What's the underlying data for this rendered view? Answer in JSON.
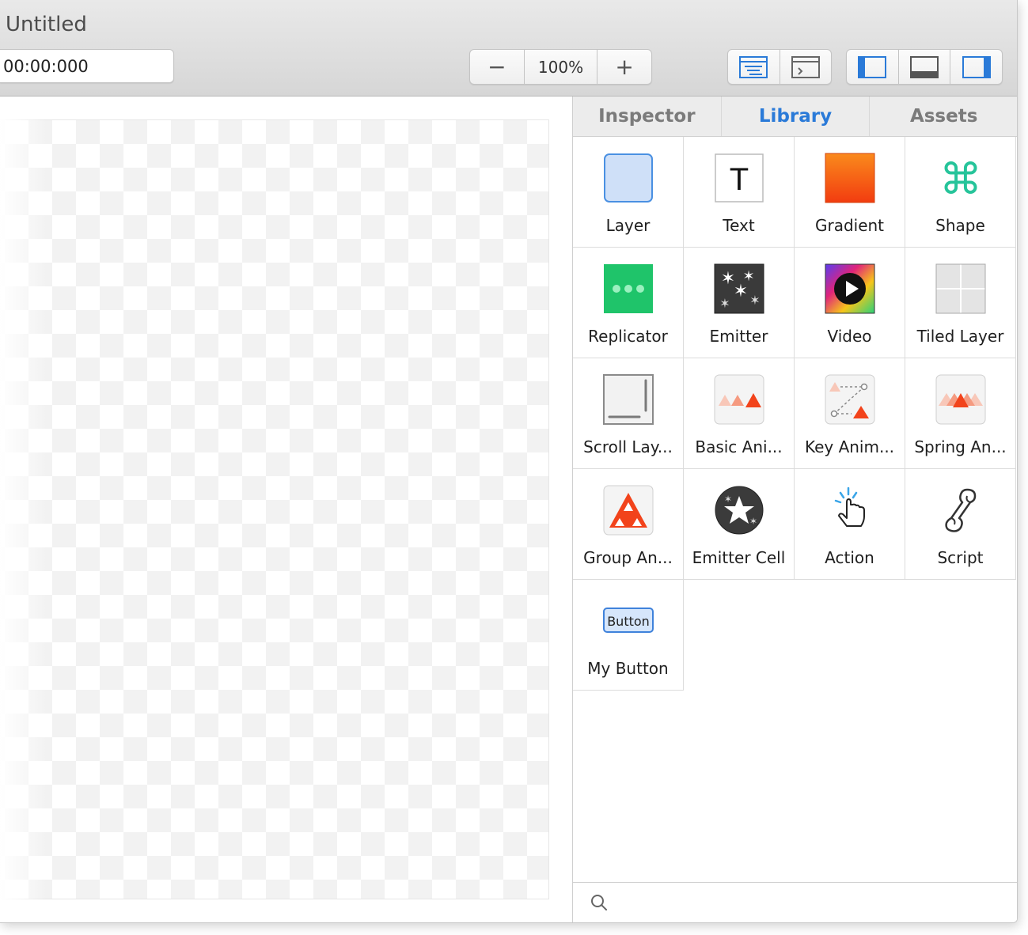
{
  "window": {
    "title": "Untitled"
  },
  "toolbar": {
    "timecode": "00:00:000",
    "zoom": {
      "minus": "−",
      "value": "100%",
      "plus": "+"
    }
  },
  "sidebar": {
    "tabs": [
      {
        "label": "Inspector",
        "active": false
      },
      {
        "label": "Library",
        "active": true
      },
      {
        "label": "Assets",
        "active": false
      }
    ],
    "library": [
      {
        "label": "Layer",
        "icon": "layer-icon"
      },
      {
        "label": "Text",
        "icon": "text-icon",
        "glyph": "T"
      },
      {
        "label": "Gradient",
        "icon": "gradient-icon"
      },
      {
        "label": "Shape",
        "icon": "shape-icon",
        "glyph": "⌘"
      },
      {
        "label": "Replicator",
        "icon": "replicator-icon"
      },
      {
        "label": "Emitter",
        "icon": "emitter-icon"
      },
      {
        "label": "Video",
        "icon": "video-icon"
      },
      {
        "label": "Tiled Layer",
        "icon": "tiled-layer-icon"
      },
      {
        "label": "Scroll Lay...",
        "icon": "scroll-layer-icon"
      },
      {
        "label": "Basic Ani...",
        "icon": "basic-animation-icon"
      },
      {
        "label": "Key Anim...",
        "icon": "keyframe-animation-icon"
      },
      {
        "label": "Spring An...",
        "icon": "spring-animation-icon"
      },
      {
        "label": "Group An...",
        "icon": "group-animation-icon"
      },
      {
        "label": "Emitter Cell",
        "icon": "emitter-cell-icon"
      },
      {
        "label": "Action",
        "icon": "action-icon"
      },
      {
        "label": "Script",
        "icon": "script-icon"
      },
      {
        "label": "My Button",
        "icon": "button-icon",
        "glyph": "Button"
      }
    ]
  },
  "colors": {
    "accent": "#2a7ad8",
    "replicator": "#1fc46a",
    "shape": "#26c49a"
  }
}
